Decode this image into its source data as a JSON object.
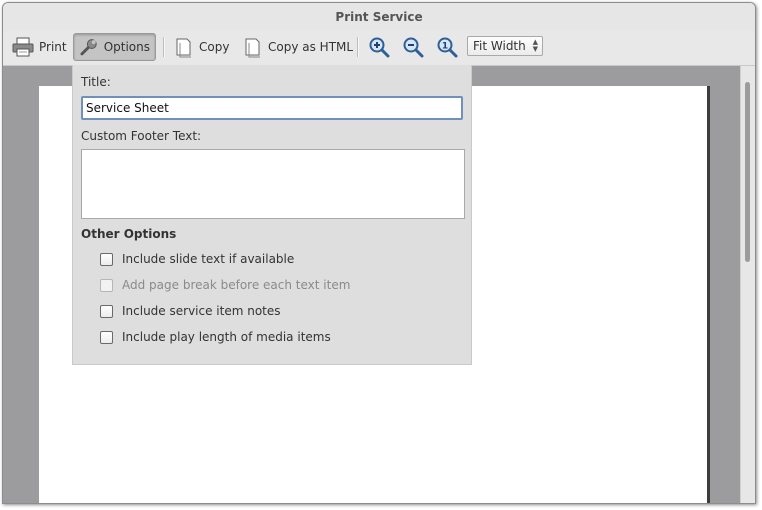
{
  "window": {
    "title": "Print Service"
  },
  "toolbar": {
    "print_label": "Print",
    "options_label": "Options",
    "copy_label": "Copy",
    "copy_html_label": "Copy as HTML",
    "zoom_value": "Fit Width",
    "zoom_options": [
      "Fit Width"
    ]
  },
  "options": {
    "title_label": "Title:",
    "title_value": "Service Sheet",
    "footer_label": "Custom Footer Text:",
    "footer_value": "",
    "other_options_heading": "Other Options",
    "items": [
      {
        "label": "Include slide text if available",
        "checked": false,
        "enabled": true
      },
      {
        "label": "Add page break before each text item",
        "checked": false,
        "enabled": false
      },
      {
        "label": "Include service item notes",
        "checked": false,
        "enabled": true
      },
      {
        "label": "Include play length of media items",
        "checked": false,
        "enabled": true
      }
    ]
  },
  "icons": [
    "printer-icon",
    "wrench-icon",
    "copy-icon",
    "copy-html-icon",
    "zoom-in-icon",
    "zoom-out-icon",
    "zoom-original-icon"
  ],
  "colors": {
    "focus_border": "#6f90ba",
    "preview_background": "#9c9c9f",
    "panel_background": "#dedede"
  }
}
